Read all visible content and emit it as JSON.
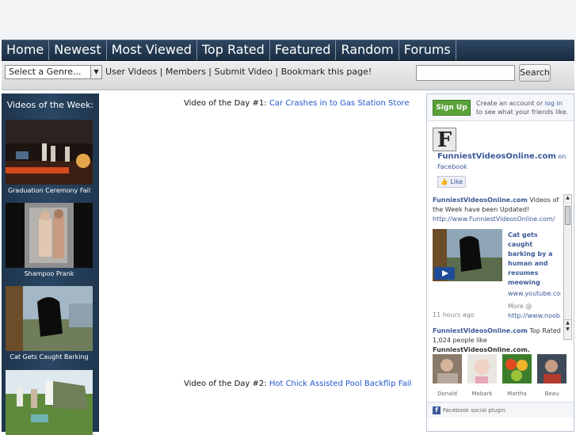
{
  "nav": {
    "items": [
      "Home",
      "Newest",
      "Most Viewed",
      "Top Rated",
      "Featured",
      "Random",
      "Forums"
    ]
  },
  "toolbar": {
    "genre_selected": "Select a Genre...",
    "links": [
      "User Videos",
      "Members",
      "Submit Video",
      "Bookmark this page!"
    ],
    "separator": " | ",
    "search_value": "",
    "search_label": "Search"
  },
  "sidebar": {
    "title": "Videos of the Week:",
    "videos": [
      {
        "label": "Graduation Ceremony Fail"
      },
      {
        "label": "Shampoo Prank"
      },
      {
        "label": "Cat Gets Caught Barking"
      },
      {
        "label": ""
      }
    ]
  },
  "main": {
    "video1_prefix": "Video of the Day #1: ",
    "video1_title": "Car Crashes in to Gas Station Store",
    "video2_prefix": "Video of the Day #2: ",
    "video2_title": "Hot Chick Assisted Pool Backflip Fail"
  },
  "facebook": {
    "signup_label": "Sign Up",
    "prompt_before": "Create an account or ",
    "login_label": "log in",
    "prompt_after": " to see what your friends like.",
    "logo_letter": "F",
    "page_name": "FunniestVideosOnline.com",
    "page_name_suffix": " on",
    "on_facebook": "Facebook",
    "like_label": "Like",
    "post1_author": "FunniestVideosOnline.com",
    "post1_text": " Videos of the Week have been Updated!",
    "post1_link": "http://www.FunniestVideosOnline.com/",
    "post1_video_title": "Cat gets caught barking by a human and resumes meowing",
    "post1_domain": "www.youtube.com",
    "post1_more": "More @",
    "post1_more_link": "http://www.noob.us",
    "post1_time": "11 hours ago",
    "post2_author": "FunniestVideosOnline.com",
    "post2_text": " Top Rated",
    "likes_count": "1,024 people like ",
    "likes_page": "FunniestVideosOnline.com.",
    "fans": [
      "Donald",
      "Mobark",
      "Martha",
      "Beau"
    ],
    "footer": "Facebook social plugin"
  }
}
